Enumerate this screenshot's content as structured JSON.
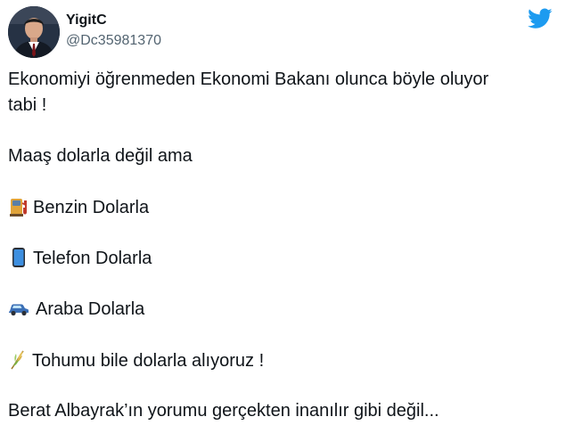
{
  "tweet": {
    "author_name": "YigitC",
    "author_handle": "@Dc35981370",
    "lines": {
      "l1": "Ekonomiyi öğrenmeden Ekonomi Bakanı olunca böyle oluyor",
      "l2": "tabi !",
      "l3": "Maaş dolarla değil ama",
      "l4": "Benzin Dolarla",
      "l5": "Telefon Dolarla",
      "l6": "Araba Dolarla",
      "l7": "Tohumu bile dolarla alıyoruz !",
      "l8": "Berat Albayrak’ın yorumu gerçekten inanılır gibi değil..."
    },
    "emoji_icons": [
      "fuel-pump-icon",
      "mobile-phone-icon",
      "car-icon",
      "sheaf-of-rice-icon"
    ]
  },
  "colors": {
    "twitter_blue": "#1d9bf0",
    "text": "#0f1419",
    "secondary_text": "#536471"
  }
}
